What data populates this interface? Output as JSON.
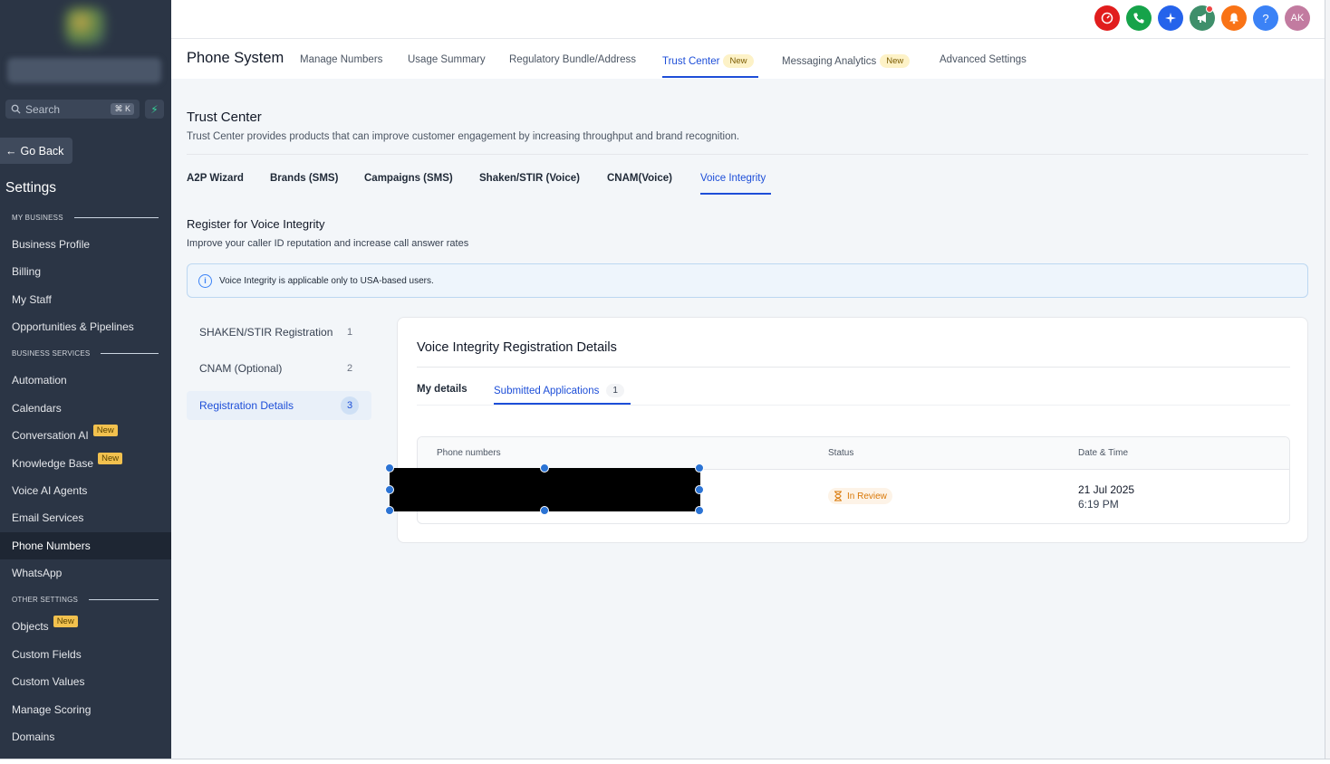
{
  "sidebar": {
    "search_placeholder": "Search",
    "search_shortcut": "⌘ K",
    "go_back": "Go Back",
    "settings_title": "Settings",
    "sections": {
      "my_business": "MY BUSINESS",
      "business_services": "BUSINESS SERVICES",
      "other_settings": "OTHER SETTINGS"
    },
    "items": [
      {
        "label": "Business Profile"
      },
      {
        "label": "Billing"
      },
      {
        "label": "My Staff"
      },
      {
        "label": "Opportunities & Pipelines"
      },
      {
        "label": "Automation"
      },
      {
        "label": "Calendars"
      },
      {
        "label": "Conversation AI",
        "badge": "New"
      },
      {
        "label": "Knowledge Base",
        "badge": "New"
      },
      {
        "label": "Voice AI Agents"
      },
      {
        "label": "Email Services"
      },
      {
        "label": "Phone Numbers",
        "active": true
      },
      {
        "label": "WhatsApp"
      },
      {
        "label": "Objects",
        "badge": "New"
      },
      {
        "label": "Custom Fields"
      },
      {
        "label": "Custom Values"
      },
      {
        "label": "Manage Scoring"
      },
      {
        "label": "Domains"
      }
    ]
  },
  "topbar": {
    "icons": [
      {
        "name": "speedometer-icon",
        "color": "#e11d1d"
      },
      {
        "name": "phone-icon",
        "color": "#16a34a"
      },
      {
        "name": "sparkle-icon",
        "color": "#2563eb"
      },
      {
        "name": "megaphone-icon",
        "color": "#3f8f6b"
      },
      {
        "name": "bell-icon",
        "color": "#f97316"
      },
      {
        "name": "help-icon",
        "color": "#3b82f6"
      },
      {
        "name": "avatar",
        "color": "#c27ba0"
      }
    ],
    "help_glyph": "?",
    "avatar_initials": "AK"
  },
  "header": {
    "title": "Phone System",
    "tabs": [
      {
        "label": "Manage Numbers"
      },
      {
        "label": "Usage Summary"
      },
      {
        "label": "Regulatory Bundle/Address"
      },
      {
        "label": "Trust Center",
        "badge": "New",
        "active": true
      },
      {
        "label": "Messaging Analytics",
        "badge": "New"
      },
      {
        "label": "Advanced Settings"
      }
    ]
  },
  "trust_center": {
    "title": "Trust Center",
    "description": "Trust Center provides products that can improve customer engagement by increasing throughput and brand recognition.",
    "tabs": [
      {
        "label": "A2P Wizard"
      },
      {
        "label": "Brands (SMS)"
      },
      {
        "label": "Campaigns (SMS)"
      },
      {
        "label": "Shaken/STIR (Voice)"
      },
      {
        "label": "CNAM(Voice)"
      },
      {
        "label": "Voice Integrity",
        "active": true
      }
    ]
  },
  "voice_integrity": {
    "title": "Register for Voice Integrity",
    "description": "Improve your caller ID reputation and increase call answer rates",
    "info": "Voice Integrity is applicable only to USA-based users.",
    "steps": [
      {
        "label": "SHAKEN/STIR Registration",
        "num": "1"
      },
      {
        "label": "CNAM (Optional)",
        "num": "2"
      },
      {
        "label": "Registration Details",
        "num": "3",
        "active": true
      }
    ]
  },
  "card": {
    "title": "Voice Integrity Registration Details",
    "tab_my_details": "My details",
    "tab_submitted": "Submitted Applications",
    "submitted_count": "1",
    "columns": [
      "Phone numbers",
      "Status",
      "Date & Time"
    ],
    "row": {
      "phone": "",
      "status": "In Review",
      "date": "21 Jul 2025",
      "time": "6:19 PM"
    }
  }
}
